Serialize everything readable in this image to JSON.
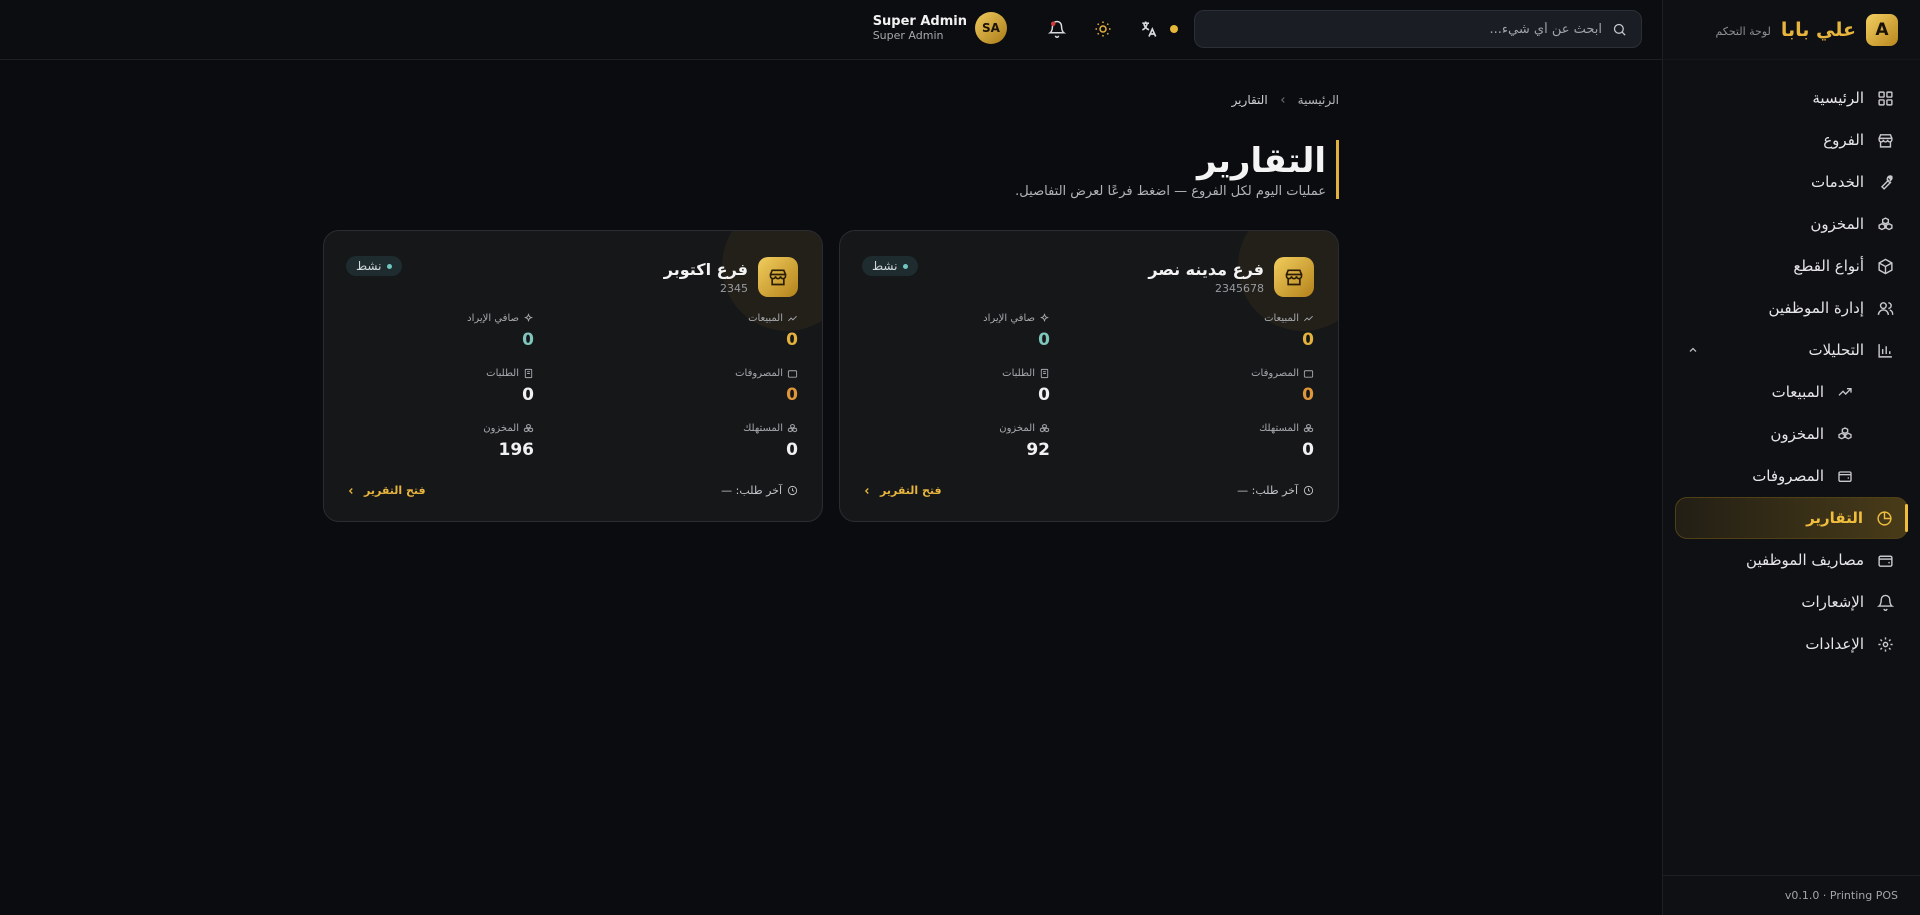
{
  "brand": {
    "logo_letter": "A",
    "name": "علي بابا",
    "subtitle": "لوحة التحكم"
  },
  "sidebar": {
    "items": [
      {
        "label": "الرئيسية",
        "icon": "grid-icon"
      },
      {
        "label": "الفروع",
        "icon": "store-icon"
      },
      {
        "label": "الخدمات",
        "icon": "wrench-icon"
      },
      {
        "label": "المخزون",
        "icon": "boxes-icon"
      },
      {
        "label": "أنواع القطع",
        "icon": "package-icon"
      },
      {
        "label": "إدارة الموظفين",
        "icon": "users-icon"
      },
      {
        "label": "التحليلات",
        "icon": "bar-chart-icon",
        "expanded": true
      },
      {
        "label": "المبيعات",
        "icon": "trending-up-icon",
        "sub": true
      },
      {
        "label": "المخزون",
        "icon": "boxes-icon",
        "sub": true
      },
      {
        "label": "المصروفات",
        "icon": "wallet-icon",
        "sub": true
      },
      {
        "label": "التقارير",
        "icon": "pie-chart-icon",
        "active": true
      },
      {
        "label": "مصاريف الموظفين",
        "icon": "wallet-icon"
      },
      {
        "label": "الإشعارات",
        "icon": "bell-icon"
      },
      {
        "label": "الإعدادات",
        "icon": "gear-icon"
      }
    ],
    "footer": "v0.1.0 · Printing POS"
  },
  "header": {
    "search_placeholder": "ابحث عن أي شيء...",
    "user": {
      "initials": "SA",
      "name": "Super Admin",
      "role": "Super Admin"
    }
  },
  "breadcrumb": {
    "home": "الرئيسية",
    "current": "التقارير"
  },
  "page": {
    "title": "التقارير",
    "subtitle": "عمليات اليوم لكل الفروع — اضغط فرعًا لعرض التفاصيل."
  },
  "labels": {
    "sales": "المبيعات",
    "net_revenue": "صافي الإيراد",
    "expenses": "المصروفات",
    "orders": "الطلبات",
    "consumed": "المستهلك",
    "inventory": "المخزون",
    "last_order": "آخر طلب: —",
    "open_report": "فتح التقرير",
    "status_active": "نشط"
  },
  "branches": [
    {
      "name": "فرع مدينه نصر",
      "code": "2345678",
      "sales": "0",
      "net_revenue": "0",
      "expenses": "0",
      "orders": "0",
      "consumed": "0",
      "inventory": "92"
    },
    {
      "name": "فرع اكتوبر",
      "code": "2345",
      "sales": "0",
      "net_revenue": "0",
      "expenses": "0",
      "orders": "0",
      "consumed": "0",
      "inventory": "196"
    }
  ],
  "colors": {
    "accent": "#e7b53d",
    "background": "#0b0c10",
    "teal": "#7fc6bc",
    "orange": "#e0963a"
  }
}
